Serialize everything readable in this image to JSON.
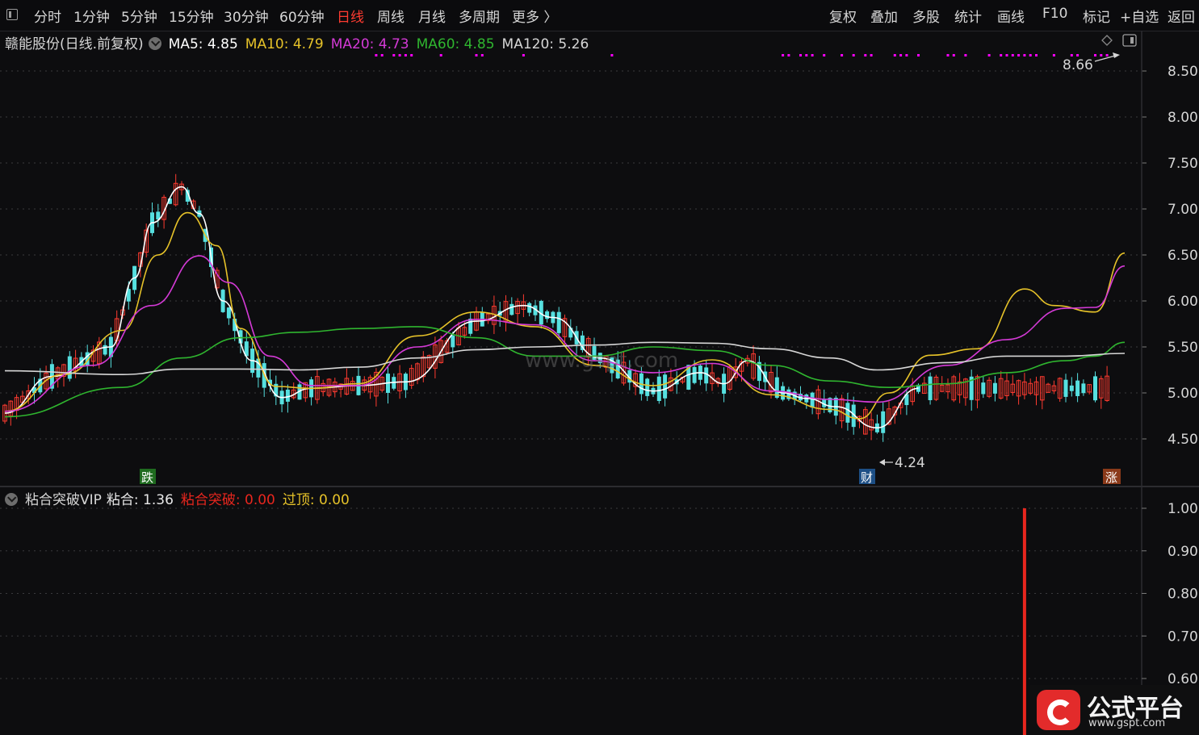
{
  "toolbar": {
    "periods": [
      "分时",
      "1分钟",
      "5分钟",
      "15分钟",
      "30分钟",
      "60分钟",
      "日线",
      "周线",
      "月线",
      "多周期",
      "更多 〉"
    ],
    "active": "日线",
    "actions": [
      "复权",
      "叠加",
      "多股",
      "统计",
      "画线",
      "F10",
      "标记",
      "+自选",
      "返回"
    ]
  },
  "main_legend": {
    "title": "赣能股份(日线.前复权)",
    "items": [
      {
        "label": "MA5: 4.85",
        "color": "#ffffff"
      },
      {
        "label": "MA10: 4.79",
        "color": "#e6c229"
      },
      {
        "label": "MA20: 4.73",
        "color": "#d43ad6"
      },
      {
        "label": "MA60: 4.85",
        "color": "#2fb52f"
      },
      {
        "label": "MA120: 5.26",
        "color": "#d6d6d6"
      }
    ]
  },
  "sub_legend": {
    "title": "粘合突破VIP",
    "items": [
      {
        "label": "粘合: 1.36",
        "color": "#e8e8e8"
      },
      {
        "label": "粘合突破: 0.00",
        "color": "#e8261e"
      },
      {
        "label": "过顶: 0.00",
        "color": "#e6c229"
      }
    ]
  },
  "markers": {
    "high": "8.66",
    "low": "4.24",
    "tags": [
      "跌",
      "财",
      "涨"
    ]
  },
  "watermark": "www.gspt.com",
  "logo": {
    "title": "公式平台",
    "url": "www.gspt.com"
  },
  "colors": {
    "up": "#ff3b30",
    "down": "#56e0e0",
    "signal": "#ff00ff",
    "bar": "#e8261e"
  },
  "chart_data": [
    {
      "type": "candlestick",
      "ylim": [
        4.2,
        8.8
      ],
      "yticks": [
        "8.50",
        "8.00",
        "7.50",
        "7.00",
        "6.50",
        "6.00",
        "5.50",
        "5.00",
        "4.50"
      ],
      "series": [
        {
          "name": "MA5",
          "x": [
            0,
            8,
            18,
            22,
            25,
            30,
            33,
            37,
            42,
            47,
            52,
            60,
            68,
            80,
            88,
            93,
            101,
            110,
            118,
            122,
            126,
            132,
            136,
            141,
            148,
            155
          ],
          "y": [
            4.78,
            5.18,
            5.5,
            6.25,
            6.85,
            7.24,
            6.95,
            6.0,
            5.35,
            4.95,
            5.05,
            5.08,
            5.12,
            5.78,
            5.95,
            5.82,
            5.38,
            5.02,
            5.22,
            5.1,
            5.35,
            5.0,
            4.94,
            4.85,
            4.62,
            5.05
          ]
        },
        {
          "name": "MA10",
          "x": [
            0,
            10,
            20,
            26,
            31,
            36,
            40,
            46,
            52,
            60,
            70,
            80,
            90,
            100,
            110,
            120,
            130,
            140,
            145,
            150,
            157,
            165,
            173,
            178,
            185,
            190
          ],
          "y": [
            4.8,
            5.2,
            5.68,
            6.5,
            6.96,
            6.6,
            5.7,
            5.07,
            5.05,
            5.1,
            5.62,
            5.88,
            5.72,
            5.3,
            5.08,
            5.36,
            4.98,
            4.82,
            4.72,
            5.0,
            5.41,
            5.48,
            6.13,
            5.95,
            5.88,
            6.52
          ]
        },
        {
          "name": "MA20",
          "x": [
            0,
            15,
            25,
            33,
            38,
            45,
            52,
            60,
            70,
            80,
            90,
            100,
            110,
            120,
            130,
            140,
            148,
            160,
            170,
            180,
            185,
            190
          ],
          "y": [
            4.8,
            5.3,
            5.95,
            6.49,
            6.2,
            5.4,
            5.08,
            5.08,
            5.5,
            5.8,
            5.74,
            5.35,
            5.22,
            5.32,
            5.02,
            4.93,
            4.9,
            5.3,
            5.58,
            5.92,
            5.93,
            6.38
          ]
        },
        {
          "name": "MA60",
          "x": [
            0,
            20,
            30,
            40,
            50,
            60,
            70,
            80,
            90,
            100,
            110,
            120,
            130,
            140,
            150,
            160,
            170,
            180,
            185,
            190
          ],
          "y": [
            4.74,
            5.06,
            5.38,
            5.6,
            5.66,
            5.7,
            5.72,
            5.6,
            5.4,
            5.4,
            5.5,
            5.46,
            5.3,
            5.13,
            5.06,
            5.1,
            5.22,
            5.35,
            5.4,
            5.55
          ]
        },
        {
          "name": "MA120",
          "x": [
            0,
            20,
            30,
            40,
            50,
            60,
            70,
            80,
            90,
            100,
            110,
            120,
            130,
            140,
            148,
            160,
            170,
            180,
            190
          ],
          "y": [
            5.24,
            5.2,
            5.26,
            5.26,
            5.25,
            5.28,
            5.38,
            5.47,
            5.5,
            5.52,
            5.55,
            5.54,
            5.48,
            5.38,
            5.25,
            5.33,
            5.4,
            5.4,
            5.43
          ]
        }
      ]
    },
    {
      "type": "bar",
      "name": "粘合突破VIP",
      "ylim": [
        0.55,
        1.05
      ],
      "yticks": [
        "1.00",
        "0.90",
        "0.80",
        "0.70",
        "0.60"
      ],
      "series": [
        {
          "name": "粘合突破",
          "x": [
            173
          ],
          "values": [
            1.0
          ]
        }
      ]
    }
  ]
}
